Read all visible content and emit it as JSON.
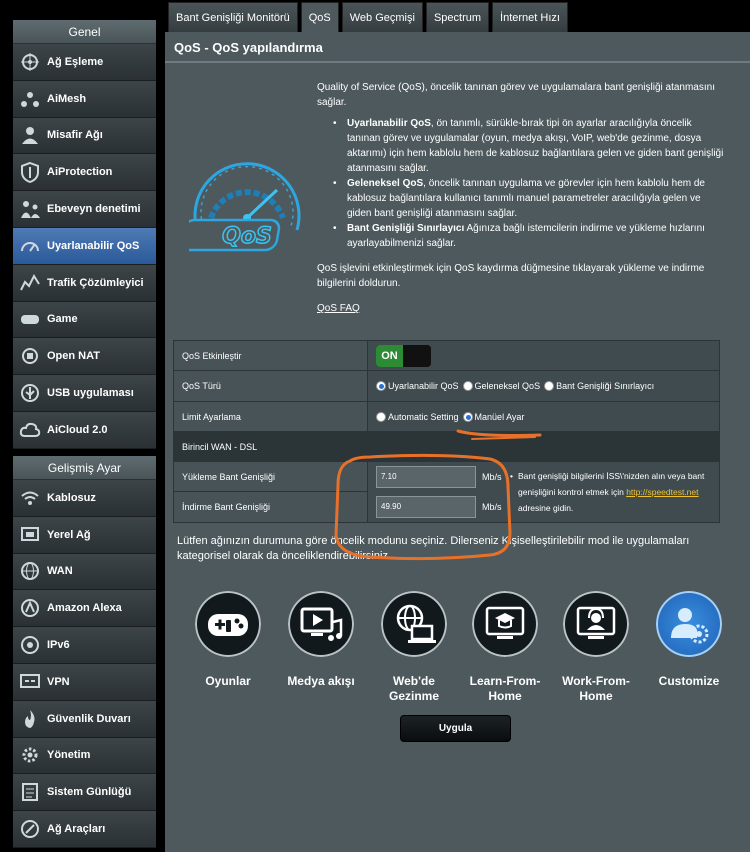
{
  "sidebar": {
    "general_header": "Genel",
    "general_items": [
      {
        "label": "Ağ Eşleme",
        "icon": "network-map-icon"
      },
      {
        "label": "AiMesh",
        "icon": "aimesh-icon"
      },
      {
        "label": "Misafir Ağı",
        "icon": "guest-network-icon"
      },
      {
        "label": "AiProtection",
        "icon": "shield-icon"
      },
      {
        "label": "Ebeveyn denetimi",
        "icon": "parental-control-icon"
      },
      {
        "label": "Uyarlanabilir QoS",
        "icon": "speedometer-icon",
        "active": true
      },
      {
        "label": "Trafik Çözümleyici",
        "icon": "traffic-analyzer-icon"
      },
      {
        "label": "Game",
        "icon": "gamepad-icon"
      },
      {
        "label": "Open NAT",
        "icon": "open-nat-icon"
      },
      {
        "label": "USB uygulaması",
        "icon": "usb-icon"
      },
      {
        "label": "AiCloud 2.0",
        "icon": "cloud-icon"
      }
    ],
    "advanced_header": "Gelişmiş Ayar",
    "advanced_items": [
      {
        "label": "Kablosuz",
        "icon": "wireless-icon"
      },
      {
        "label": "Yerel Ağ",
        "icon": "lan-icon"
      },
      {
        "label": "WAN",
        "icon": "globe-icon"
      },
      {
        "label": "Amazon Alexa",
        "icon": "alexa-icon"
      },
      {
        "label": "IPv6",
        "icon": "ipv6-icon"
      },
      {
        "label": "VPN",
        "icon": "vpn-icon"
      },
      {
        "label": "Güvenlik Duvarı",
        "icon": "firewall-icon"
      },
      {
        "label": "Yönetim",
        "icon": "gear-icon"
      },
      {
        "label": "Sistem Günlüğü",
        "icon": "log-icon"
      },
      {
        "label": "Ağ Araçları",
        "icon": "tools-icon"
      }
    ]
  },
  "tabs": [
    {
      "label": "Bant Genişliği Monitörü"
    },
    {
      "label": "QoS",
      "active": true
    },
    {
      "label": "Web Geçmişi"
    },
    {
      "label": "Spectrum"
    },
    {
      "label": "İnternet Hızı"
    }
  ],
  "page": {
    "title": "QoS - QoS yapılandırma",
    "intro": "Quality of Service (QoS), öncelik tanınan görev ve uygulamalara bant genişliği atanmasını sağlar.",
    "bullets": [
      {
        "bold": "Uyarlanabilir QoS",
        "text": ", ön tanımlı, sürükle-bırak tipi ön ayarlar aracılığıyla öncelik tanınan görev ve uygulamalar (oyun, medya akışı, VoIP, web'de gezinme, dosya aktarımı) için hem kablolu hem de kablosuz bağlantılara gelen ve giden bant genişliği atanmasını sağlar."
      },
      {
        "bold": "Geleneksel QoS",
        "text": ", öncelik tanınan uygulama ve görevler için hem kablolu hem de kablosuz bağlantılara kullanıcı tanımlı manuel parametreler aracılığıyla gelen ve giden bant genişliği atanmasını sağlar."
      },
      {
        "bold": "Bant Genişliği Sınırlayıcı",
        "text": " Ağınıza bağlı istemcilerin indirme ve yükleme hızlarını ayarlayabilmenizi sağlar."
      }
    ],
    "enable_note": "QoS işlevini etkinleştirmek için QoS kaydırma düğmesine tıklayarak yükleme ve indirme bilgilerini doldurun.",
    "faq": "QoS FAQ"
  },
  "settings": {
    "enable_label": "QoS Etkinleştir",
    "enable_state": "ON",
    "type_label": "QoS Türü",
    "type_options": [
      "Uyarlanabilir QoS",
      "Geleneksel QoS",
      "Bant Genişliği Sınırlayıcı"
    ],
    "type_selected": 0,
    "limit_label": "Limit Ayarlama",
    "limit_options": [
      "Automatic Setting",
      "Manüel Ayar"
    ],
    "limit_selected": 1,
    "wan_section": "Birincil WAN - DSL",
    "upload_label": "Yükleme Bant Genişliği",
    "upload_value": "7.10",
    "download_label": "İndirme Bant Genişliği",
    "download_value": "49.90",
    "unit": "Mb/s",
    "note_text": "Bant genişliği bilgilerini İSS\\'nizden alın veya bant genişliğini kontrol etmek için",
    "note_link": "http://speedtest.net",
    "note_tail": " adresine gidin."
  },
  "prompt": "Lütfen ağınızın durumuna göre öncelik modunu seçiniz. Dilerseniz Kişiselleştirilebilir mod ile uygulamaları kategorisel olarak da önceliklendirebilirsiniz.",
  "modes": [
    {
      "label": "Oyunlar",
      "icon": "gamepad-icon"
    },
    {
      "label": "Medya akışı",
      "icon": "media-icon"
    },
    {
      "label": "Web'de Gezinme",
      "icon": "web-browsing-icon"
    },
    {
      "label": "Learn-From-Home",
      "icon": "learn-icon"
    },
    {
      "label": "Work-From-Home",
      "icon": "work-icon"
    },
    {
      "label": "Customize",
      "icon": "customize-icon",
      "selected": true
    }
  ],
  "apply_label": "Uygula",
  "colors": {
    "accent_blue": "#2b5a9a",
    "toggle_green": "#2d8a35",
    "annotation": "#e8712a",
    "link": "#f0c230"
  }
}
